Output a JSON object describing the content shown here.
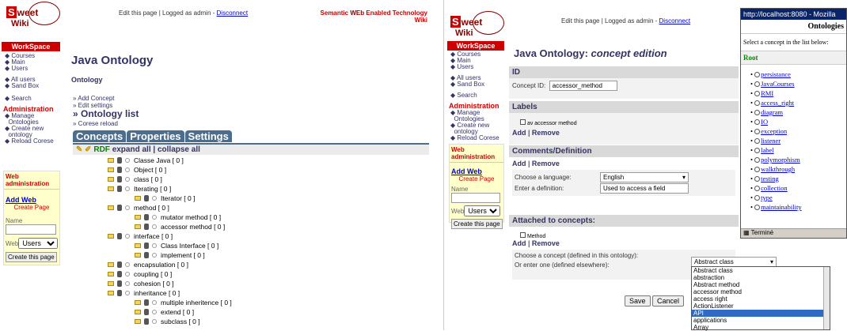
{
  "left": {
    "logo": {
      "s": "S",
      "word1": "weet",
      "word2": "Wiki"
    },
    "topbar": {
      "edit": "Edit this page",
      "sep": "|",
      "logged": "Logged as admin -",
      "disconnect": "Disconnect"
    },
    "brand": {
      "semantic": "Semantic",
      "web": "WEb",
      "rest": "Enabled Technology",
      "wiki": "Wiki"
    },
    "workspace": "WorkSpace",
    "sidebar": [
      "Courses",
      "Main",
      "Users"
    ],
    "sidebar2": [
      "All users",
      "Sand Box"
    ],
    "search": "Search",
    "administration": "Administration",
    "admin_items": [
      "Manage",
      "Ontologies",
      "Create new",
      "ontology",
      "Reload Corese"
    ],
    "webadmin": {
      "title": "Web administration",
      "addweb": "Add Web",
      "createpage": "Create Page",
      "name": "Name",
      "web": "Web",
      "select": "Users",
      "button": "Create this page"
    },
    "title": "Java Ontology",
    "subtitle": "Ontology",
    "links": [
      "» Add Concept",
      "» Edit settings"
    ],
    "ontology_list": "» Ontology list",
    "corese": "» Corese reload",
    "tabs": [
      "Concepts",
      "Properties",
      "Settings"
    ],
    "tool": {
      "rdf": "RDF",
      "expand": "expand all",
      "sep": "|",
      "collapse": "collapse all"
    },
    "tree": [
      "Classe Java [ 0 ]",
      "Object [ 0 ]",
      "class [ 0 ]",
      "Iterating [ 0 ]",
      "Iterator [ 0 ]",
      "method [ 0 ]",
      "mutator method [ 0 ]",
      "accessor method [ 0 ]",
      "interface [ 0 ]",
      "Class Interface [ 0 ]",
      "implement [ 0 ]",
      "encapsulation [ 0 ]",
      "coupling [ 0 ]",
      "cohesion [ 0 ]",
      "inheritance [ 0 ]",
      "multiple inheritence [ 0 ]",
      "extend [ 0 ]",
      "subclass [ 0 ]"
    ]
  },
  "right": {
    "topbar": {
      "edit": "Edit this page",
      "sep": "|",
      "logged": "Logged as admin -",
      "disconnect": "Disconnect"
    },
    "workspace": "WorkSpace",
    "title_main": "Java Ontology:",
    "title_em": "concept edition",
    "id_head": "ID",
    "concept_id_label": "Concept ID:",
    "concept_id_value": "accessor_method",
    "labels_head": "Labels",
    "label_item": "av accessor method",
    "add": "Add",
    "remove": "Remove",
    "comments_head": "Comments/Definition",
    "lang_label": "Choose a language:",
    "lang_value": "English",
    "def_label": "Enter a definition:",
    "def_value": "Used to access a field",
    "attached_head": "Attached to concepts:",
    "attached_item": "Method",
    "choose_label": "Choose a concept (defined in this ontology):",
    "choose_value": "Abstract class",
    "enter_label": "Or enter one (defined elsewhere):",
    "dropdown": [
      "Abstract class",
      "abstraction",
      "Abstract method",
      "accessor method",
      "access right",
      "ActionListener",
      "API",
      "applications",
      "Array"
    ],
    "dropdown_selected": "API",
    "save": "Save",
    "cancel": "Cancel"
  },
  "popup": {
    "title": "http://localhost:8080 - Mozilla",
    "head": "Ontologies",
    "instruction": "Select a concept in the list below:",
    "root": "Root",
    "items": [
      "persistance",
      "JavaCourses",
      "RMI",
      "access_right",
      "diagram",
      "IO",
      "exception",
      "listener",
      "label",
      "polymorphism",
      "walkthrough",
      "testing",
      "collection",
      "type",
      "maintainability"
    ],
    "status": "Terminé"
  }
}
